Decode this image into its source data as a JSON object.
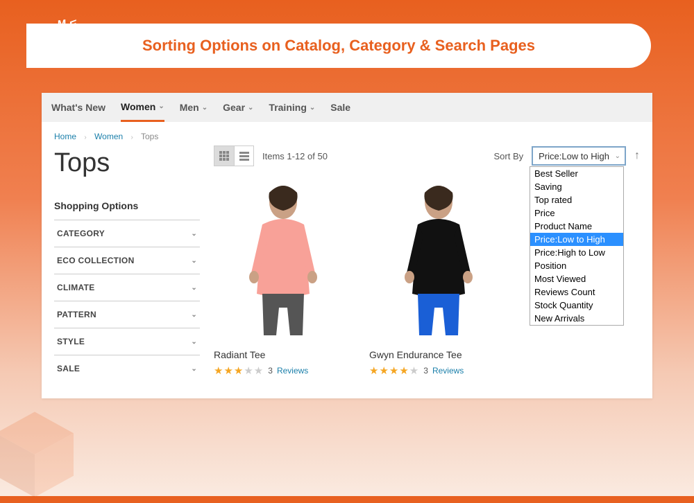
{
  "banner": {
    "title": "Sorting Options on Catalog, Category & Search Pages"
  },
  "nav": {
    "items": [
      {
        "label": "What's New",
        "hasChev": false
      },
      {
        "label": "Women",
        "hasChev": true,
        "active": true
      },
      {
        "label": "Men",
        "hasChev": true
      },
      {
        "label": "Gear",
        "hasChev": true
      },
      {
        "label": "Training",
        "hasChev": true
      },
      {
        "label": "Sale",
        "hasChev": false
      }
    ]
  },
  "breadcrumb": {
    "home": "Home",
    "women": "Women",
    "tops": "Tops"
  },
  "page_title": "Tops",
  "sidebar": {
    "heading": "Shopping Options",
    "filters": [
      "CATEGORY",
      "ECO COLLECTION",
      "CLIMATE",
      "PATTERN",
      "STYLE",
      "SALE"
    ]
  },
  "toolbar": {
    "counter": "Items 1-12 of 50",
    "sort_label": "Sort By",
    "sort_selected": "Price:Low to High",
    "sort_options": [
      "Best Seller",
      "Saving",
      "Top rated",
      "Price",
      "Product Name",
      "Price:Low to High",
      "Price:High to Low",
      "Position",
      "Most Viewed",
      "Reviews Count",
      "Stock Quantity",
      "New Arrivals"
    ]
  },
  "products": [
    {
      "name": "Radiant Tee",
      "rating": 3,
      "reviews_count": "3",
      "reviews_label": "Reviews",
      "color": "#f8a198",
      "shorts": "#555"
    },
    {
      "name": "Gwyn Endurance Tee",
      "rating": 4,
      "reviews_count": "3",
      "reviews_label": "Reviews",
      "color": "#111",
      "shorts": "#1a5fd6"
    }
  ]
}
